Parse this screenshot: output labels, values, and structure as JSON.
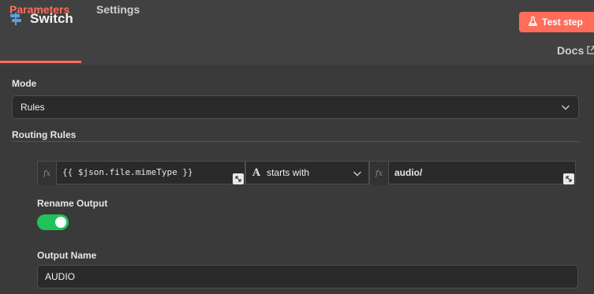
{
  "header": {
    "title": "Switch",
    "icon": "switch-signpost-icon",
    "test_button_label": "Test step",
    "test_button_icon": "flask-icon",
    "accent_color": "#ff6d5a"
  },
  "tabs": [
    {
      "label": "Parameters",
      "active": true
    },
    {
      "label": "Settings",
      "active": false
    }
  ],
  "docs": {
    "label": "Docs",
    "icon": "external-link-icon"
  },
  "mode": {
    "label": "Mode",
    "value": "Rules"
  },
  "routing_rules": {
    "label": "Routing Rules",
    "rules": [
      {
        "left_value": "{{ $json.file.mimeType }}",
        "operator": "starts with",
        "operator_icon": "type-A-icon",
        "right_value": "audio/"
      }
    ]
  },
  "rename_output": {
    "label": "Rename Output",
    "enabled": true,
    "color": "#1fc35a"
  },
  "output_name": {
    "label": "Output Name",
    "value": "AUDIO"
  },
  "fx_label": "fx"
}
